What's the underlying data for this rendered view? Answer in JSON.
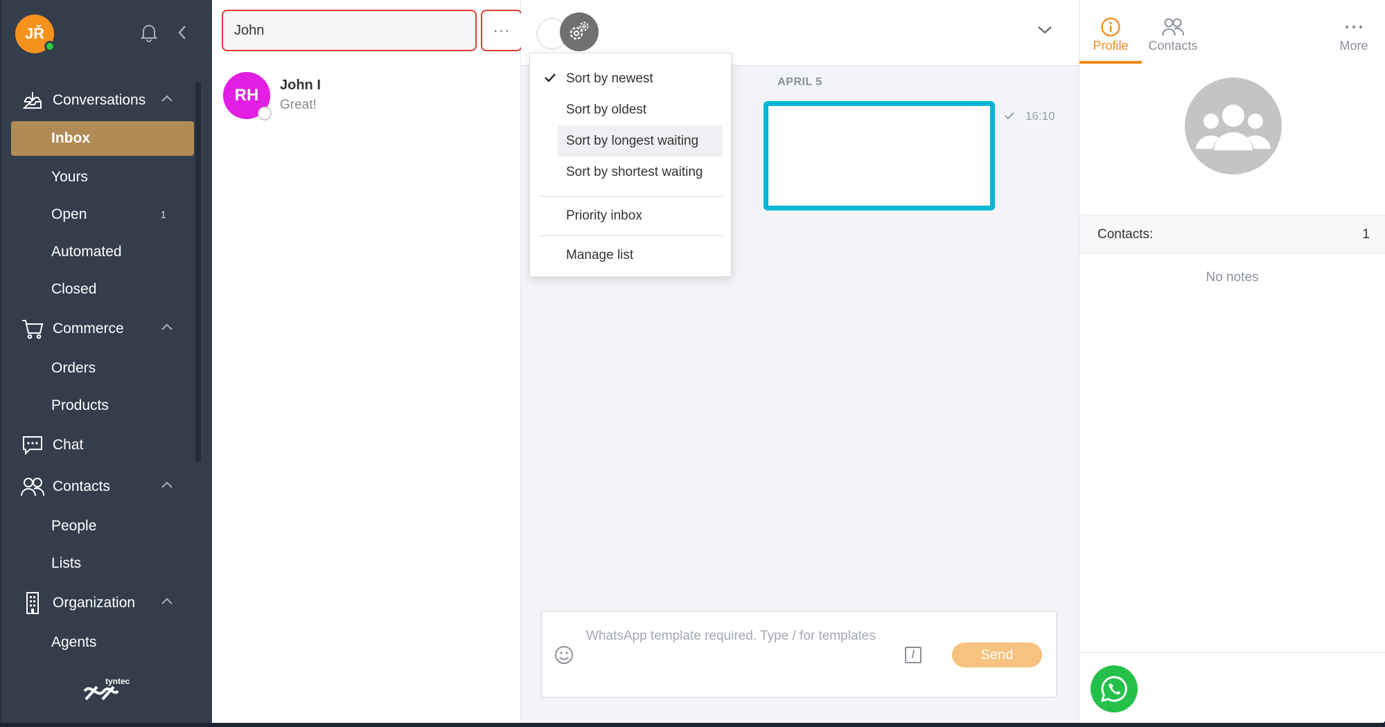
{
  "sidebar": {
    "user_initials": "JŘ",
    "groups": [
      {
        "label": "Conversations",
        "icon": "inbox-tray-icon",
        "items": [
          {
            "label": "Inbox",
            "active": true
          },
          {
            "label": "Yours"
          },
          {
            "label": "Open",
            "count": "1"
          },
          {
            "label": "Automated"
          },
          {
            "label": "Closed"
          }
        ]
      },
      {
        "label": "Commerce",
        "icon": "cart-icon",
        "items": [
          {
            "label": "Orders"
          },
          {
            "label": "Products"
          }
        ]
      },
      {
        "label": "Chat",
        "icon": "chat-bubble-icon",
        "items": []
      },
      {
        "label": "Contacts",
        "icon": "people-icon",
        "items": [
          {
            "label": "People"
          },
          {
            "label": "Lists"
          }
        ]
      },
      {
        "label": "Organization",
        "icon": "building-icon",
        "items": [
          {
            "label": "Agents"
          }
        ]
      }
    ],
    "brand": "tyntec"
  },
  "conv_list": {
    "search_value": "John",
    "more_label": "···",
    "conversations": [
      {
        "initials": "RH",
        "name": "John I",
        "preview": "Great!",
        "avatar_color": "#e11ee1"
      }
    ]
  },
  "sort_menu": {
    "items": [
      "Sort by newest",
      "Sort by oldest",
      "Sort by longest waiting",
      "Sort by shortest waiting"
    ],
    "checked": "Sort by newest",
    "priority": "Priority inbox",
    "manage": "Manage list"
  },
  "chat": {
    "date_label": "APRIL 5",
    "message_time": "16:10",
    "composer_placeholder": "WhatsApp template required. Type / for templates",
    "slash_label": "/",
    "send_label": "Send"
  },
  "right_panel": {
    "tabs": {
      "profile": "Profile",
      "contacts": "Contacts",
      "more": "More"
    },
    "contacts_label": "Contacts:",
    "contacts_count": "1",
    "no_notes": "No notes"
  },
  "colors": {
    "accent": "#f08a16",
    "sidebar_bg": "#343d4c",
    "active_item": "#b08b55",
    "highlight": "#e23b2e",
    "bubble_border": "#00b6d6",
    "whatsapp": "#25c04a"
  }
}
